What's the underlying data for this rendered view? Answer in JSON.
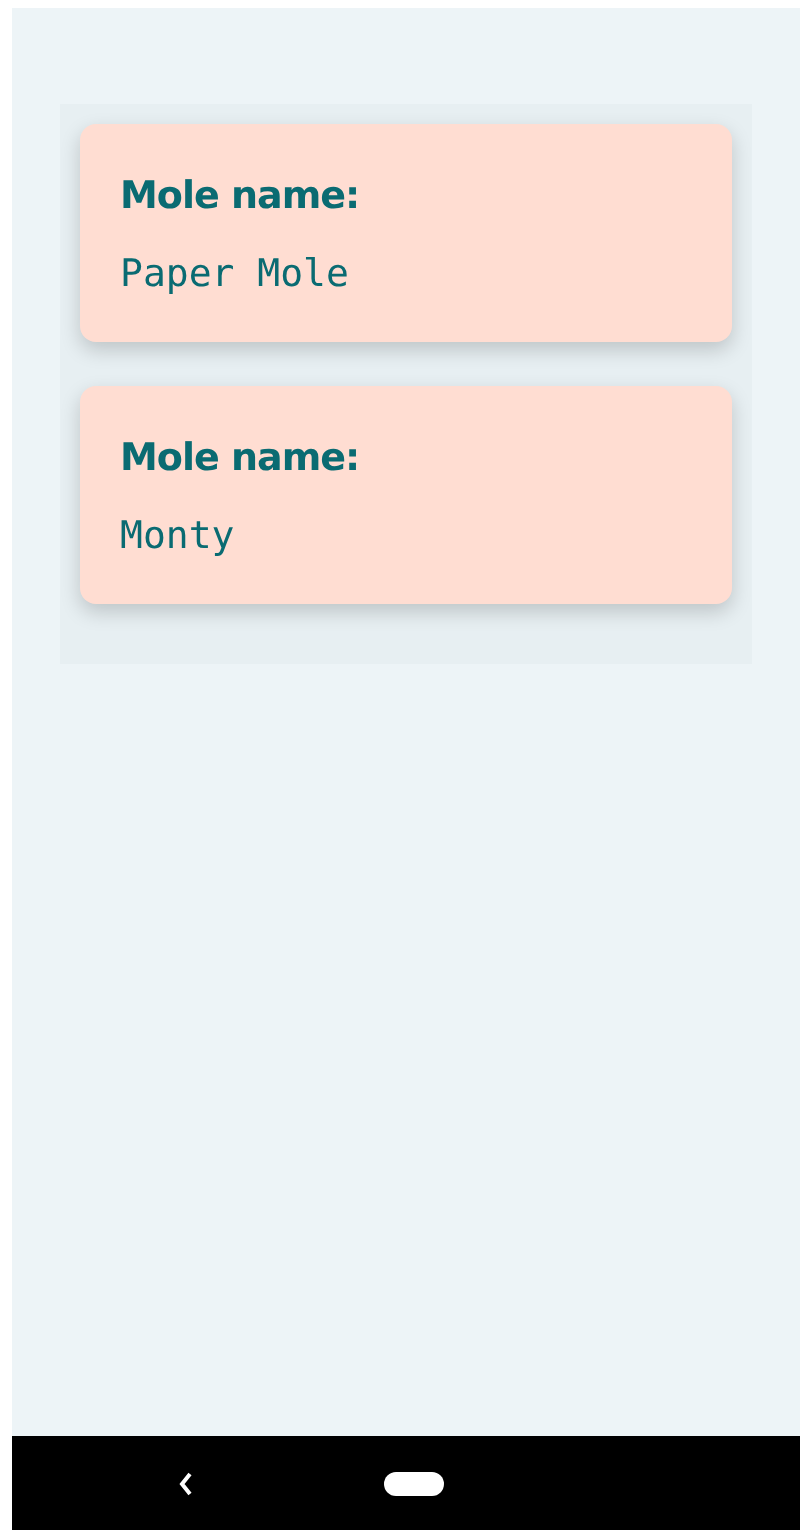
{
  "moles": [
    {
      "label": "Mole name:",
      "name": "Paper Mole"
    },
    {
      "label": "Mole name:",
      "name": "Monty"
    }
  ]
}
